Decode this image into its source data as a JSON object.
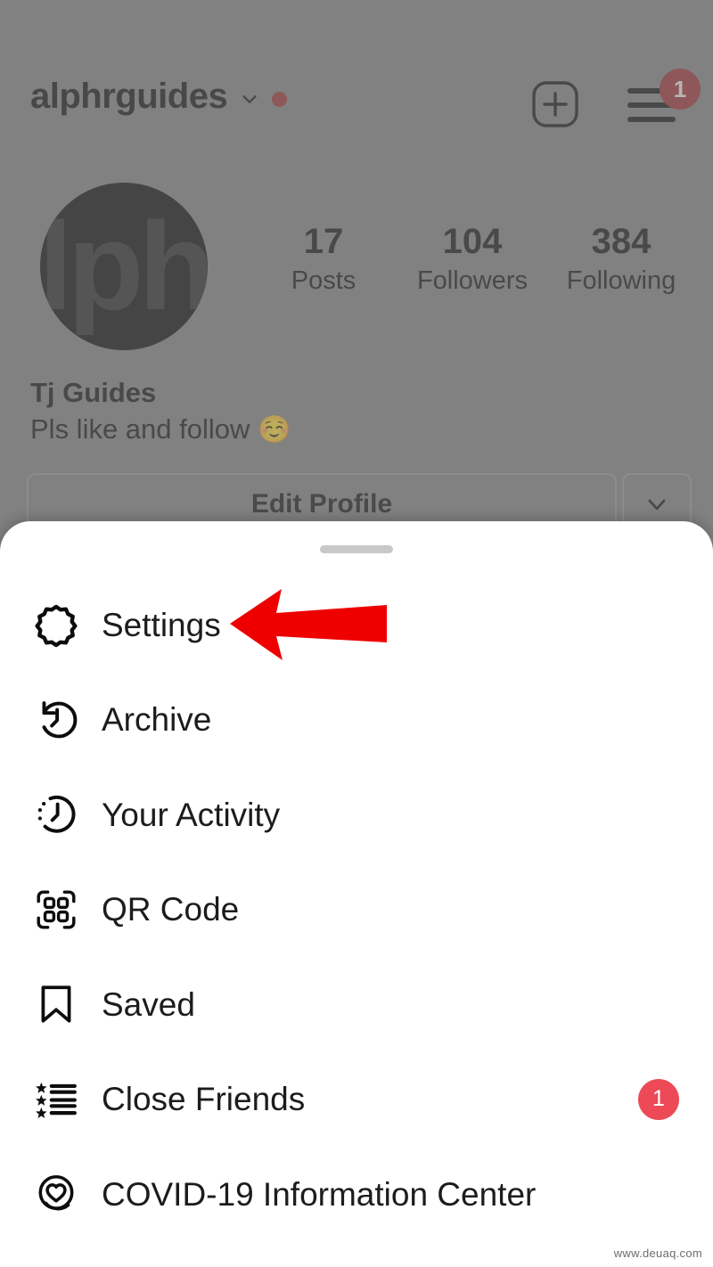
{
  "app": {
    "platform": "instagram-profile-mobile",
    "watermark": "www.deuaq.com"
  },
  "profile": {
    "username": "alphrguides",
    "dropdown_icon": "chevron-down-icon",
    "status_dot": "red-dot",
    "create_icon": "plus-square-icon",
    "menu_icon": "hamburger-icon",
    "menu_badge": "1",
    "avatar_text": "lph",
    "stats": [
      {
        "value": "17",
        "label": "Posts"
      },
      {
        "value": "104",
        "label": "Followers"
      },
      {
        "value": "384",
        "label": "Following"
      }
    ],
    "full_name": "Tj Guides",
    "bio": "Pls like and follow",
    "bio_emoji": "☺️",
    "edit_profile_label": "Edit Profile",
    "expand_icon": "chevron-down-icon"
  },
  "sheet": {
    "handle": "drag-handle",
    "items": [
      {
        "label": "Settings",
        "icon": "gear-icon",
        "badge": ""
      },
      {
        "label": "Archive",
        "icon": "archive-clock-icon",
        "badge": ""
      },
      {
        "label": "Your Activity",
        "icon": "activity-clock-icon",
        "badge": ""
      },
      {
        "label": "QR Code",
        "icon": "qr-code-icon",
        "badge": ""
      },
      {
        "label": "Saved",
        "icon": "bookmark-icon",
        "badge": ""
      },
      {
        "label": "Close Friends",
        "icon": "star-list-icon",
        "badge": "1"
      },
      {
        "label": "COVID-19 Information Center",
        "icon": "covid-heart-icon",
        "badge": ""
      }
    ]
  },
  "annotation": {
    "arrow": "red-left-arrow",
    "points_to": "Settings",
    "color": "#ef0000"
  },
  "colors": {
    "backdrop": "#828282",
    "sheet_bg": "#ffffff",
    "badge_red": "#ed4956",
    "header_badge_red": "#9e2a2e",
    "arrow_red": "#ef0000",
    "text": "#1c1c1c"
  }
}
